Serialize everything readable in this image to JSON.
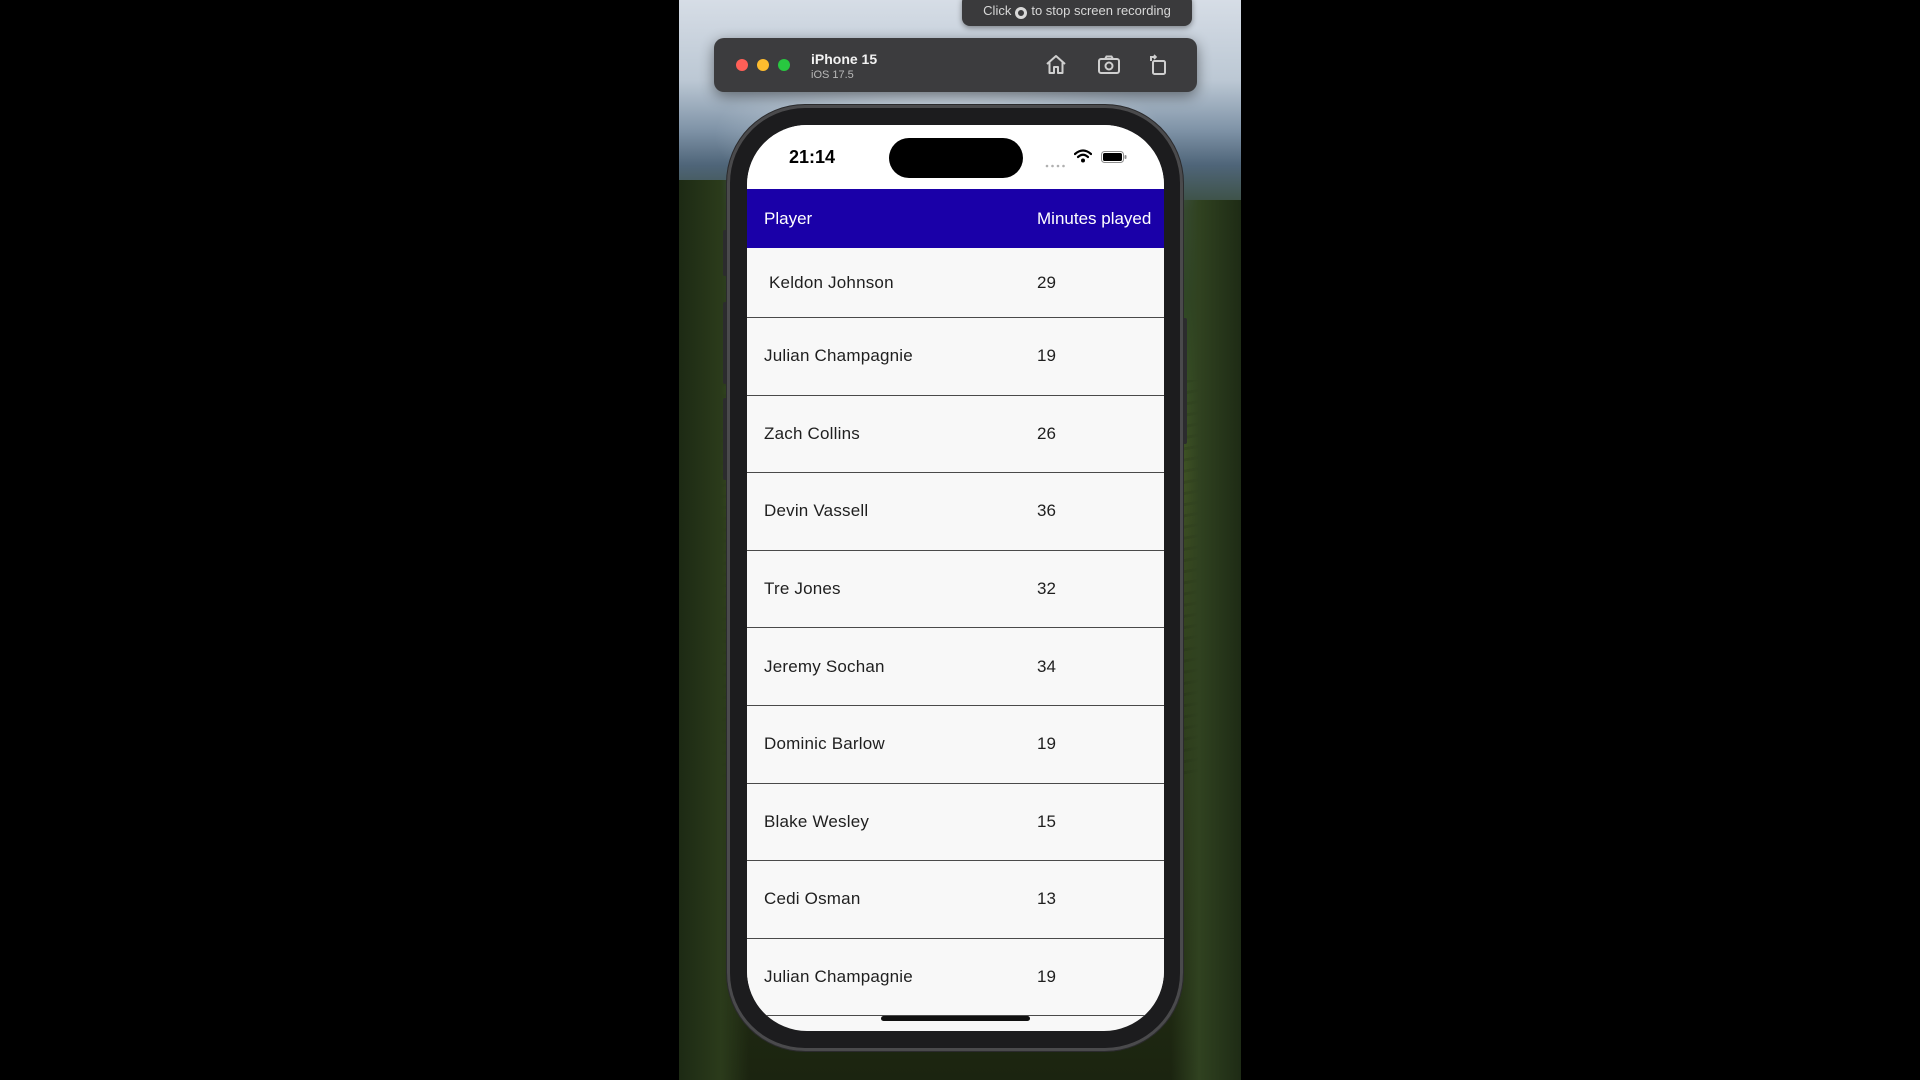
{
  "recording_banner": {
    "text_before": "Click",
    "text_after": "to stop screen recording"
  },
  "simulator": {
    "device_name": "iPhone 15",
    "os_version": "iOS 17.5",
    "icons": [
      "home-icon",
      "screenshot-icon",
      "rotate-icon"
    ]
  },
  "status_bar": {
    "time": "21:14",
    "icons": [
      "cellular-signal-icon",
      "wifi-icon",
      "battery-icon"
    ]
  },
  "table": {
    "header_color": "#1a00a8",
    "columns": [
      "Player",
      "Minutes played"
    ],
    "rows": [
      {
        "player": "Keldon Johnson",
        "minutes": "29"
      },
      {
        "player": "Julian Champagnie",
        "minutes": "19"
      },
      {
        "player": "Zach Collins",
        "minutes": "26"
      },
      {
        "player": "Devin Vassell",
        "minutes": "36"
      },
      {
        "player": "Tre Jones",
        "minutes": "32"
      },
      {
        "player": "Jeremy Sochan",
        "minutes": "34"
      },
      {
        "player": "Dominic Barlow",
        "minutes": "19"
      },
      {
        "player": "Blake Wesley",
        "minutes": "15"
      },
      {
        "player": "Cedi Osman",
        "minutes": "13"
      },
      {
        "player": "Julian Champagnie",
        "minutes": "19"
      }
    ]
  }
}
